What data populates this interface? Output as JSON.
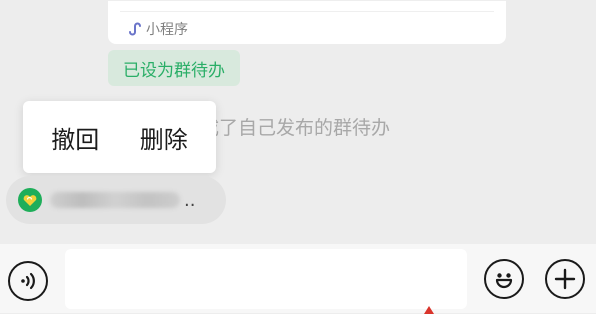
{
  "mini_program": {
    "label": "小程序",
    "icon": "mini-program-icon"
  },
  "todo_badge": {
    "label": "已设为群待办",
    "color": "#2aae67"
  },
  "system_notice": {
    "text": "成了自己发布的群待办"
  },
  "popup_menu": {
    "items": [
      "撤回",
      "删除"
    ]
  },
  "quote": {
    "avatar_icon": "heart-icon",
    "ellipsis": ".."
  },
  "input_bar": {
    "voice_icon": "voice-icon",
    "emoji_icon": "smiley-icon",
    "plus_icon": "plus-icon",
    "placeholder": ""
  }
}
